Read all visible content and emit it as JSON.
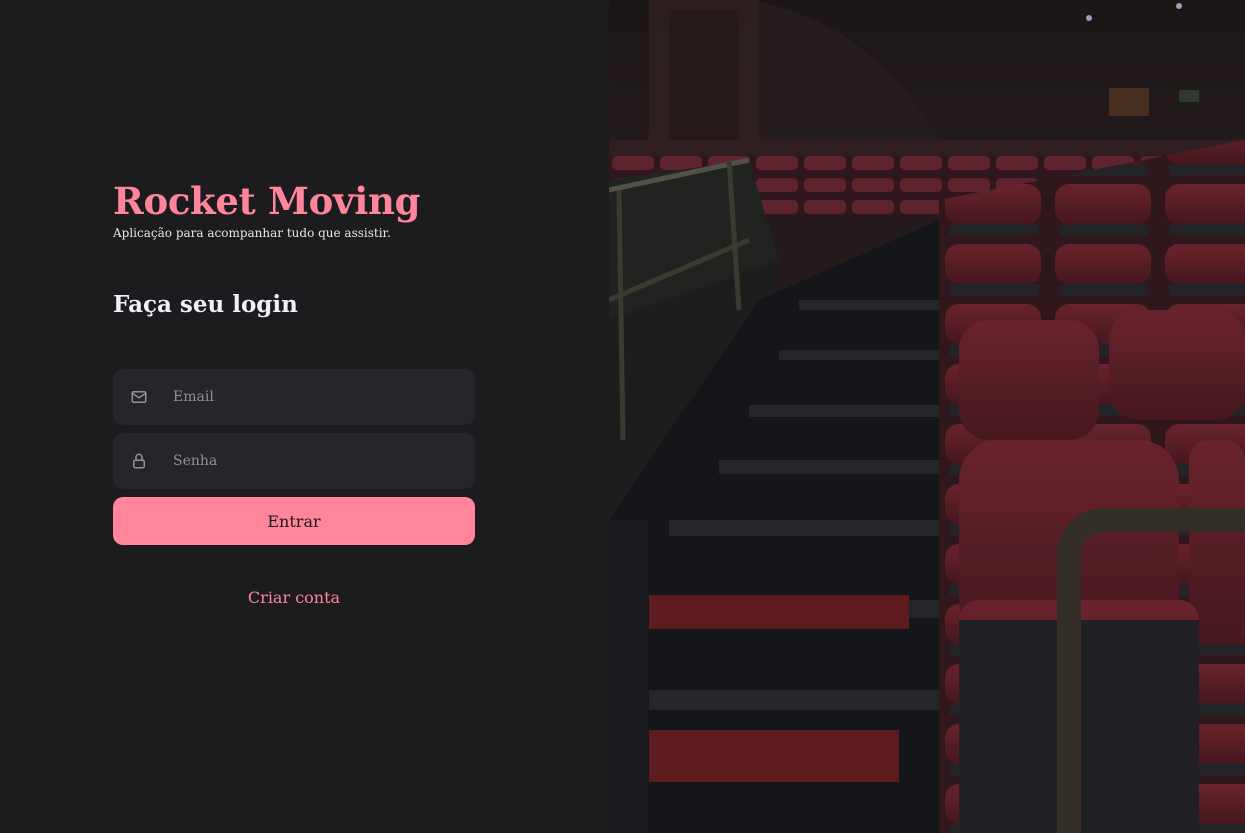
{
  "brand": {
    "title": "Rocket Moving",
    "subtitle": "Aplicação para acompanhar tudo que assistir."
  },
  "login": {
    "title": "Faça seu login",
    "email": {
      "placeholder": "Email",
      "value": "",
      "icon": "mail-icon"
    },
    "password": {
      "placeholder": "Senha",
      "value": "",
      "icon": "lock-icon"
    },
    "submit_label": "Entrar",
    "create_account_label": "Criar conta"
  },
  "background": {
    "image": "theater-seats-photo"
  },
  "colors": {
    "accent": "#ff859b",
    "background": "#1c1b1e",
    "input_bg": "#262529",
    "placeholder": "#948f99"
  }
}
